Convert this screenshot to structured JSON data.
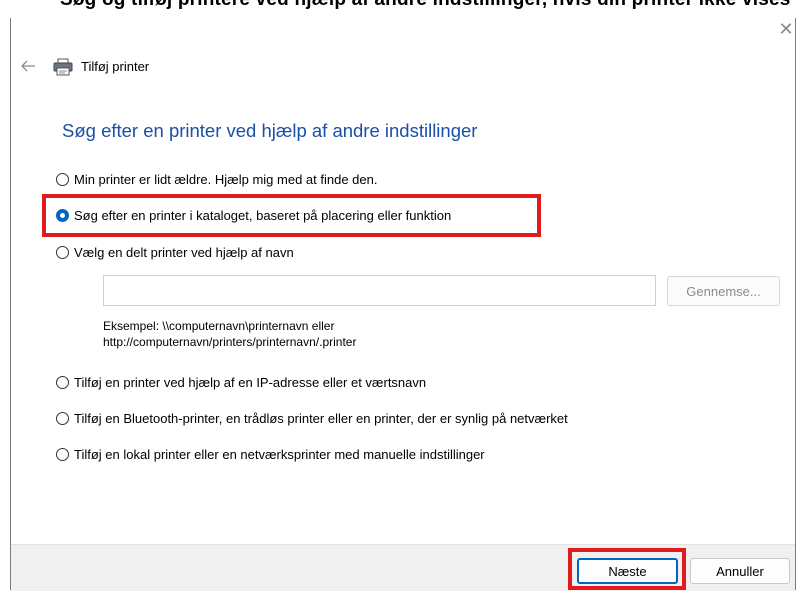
{
  "top_banner": {
    "text": "Søg og tilføj printere ved hjælp af andre indstillinger, hvis din printer ikke vises på listen"
  },
  "window": {
    "title": "Tilføj printer",
    "close_icon": "close-icon",
    "back_icon": "back-arrow-icon",
    "printer_icon": "printer-icon"
  },
  "page": {
    "heading": "Søg efter en printer ved hjælp af andre indstillinger"
  },
  "options": [
    {
      "label": "Min printer er lidt ældre. Hjælp mig med at finde den.",
      "checked": false
    },
    {
      "label": "Søg efter en printer i kataloget, baseret på placering eller funktion",
      "checked": true
    },
    {
      "label": "Vælg en delt printer ved hjælp af navn",
      "checked": false
    },
    {
      "label": "Tilføj en printer ved hjælp af en IP-adresse eller et værtsnavn",
      "checked": false
    },
    {
      "label": "Tilføj en Bluetooth-printer, en trådløs printer eller en printer, der er synlig på netværket",
      "checked": false
    },
    {
      "label": "Tilføj en lokal printer eller en netværksprinter med manuelle indstillinger",
      "checked": false
    }
  ],
  "shared_printer": {
    "input_value": "",
    "browse_label": "Gennemse...",
    "example_line1": "Eksempel: \\\\computernavn\\printernavn eller",
    "example_line2": "http://computernavn/printers/printernavn/.printer"
  },
  "footer": {
    "next_label": "Næste",
    "cancel_label": "Annuller"
  },
  "colors": {
    "heading": "#1a4fa6",
    "accent": "#0067c0",
    "highlight": "#e01b1b",
    "footer_bg": "#f0f0f0"
  }
}
